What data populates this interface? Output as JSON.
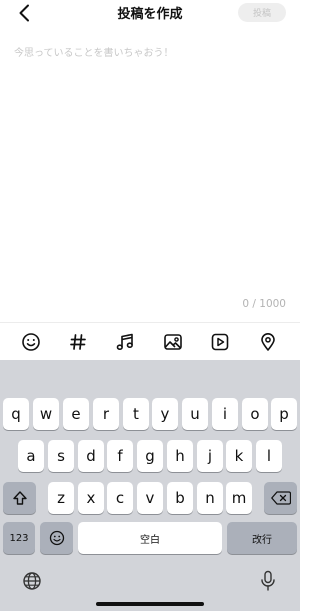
{
  "header": {
    "title": "投稿を作成",
    "post_label": "投稿"
  },
  "compose": {
    "placeholder": "今思っていることを書いちゃおう！",
    "char_count": "0 / 1000"
  },
  "toolbar": {
    "items": [
      "emoji-icon",
      "hashtag-icon",
      "music-icon",
      "image-icon",
      "video-icon",
      "location-icon"
    ]
  },
  "keyboard": {
    "row1": [
      "q",
      "w",
      "e",
      "r",
      "t",
      "y",
      "u",
      "i",
      "o",
      "p"
    ],
    "row2": [
      "a",
      "s",
      "d",
      "f",
      "g",
      "h",
      "j",
      "k",
      "l"
    ],
    "row3": [
      "z",
      "x",
      "c",
      "v",
      "b",
      "n",
      "m"
    ],
    "numbers_label": "123",
    "space_label": "空白",
    "return_label": "改行"
  },
  "colors": {
    "keyboard_bg": "#d2d4d9",
    "key_bg": "#ffffff",
    "function_key_bg": "#abb0ba",
    "placeholder": "#c8c8c8",
    "post_button_bg": "#eeeeee"
  }
}
